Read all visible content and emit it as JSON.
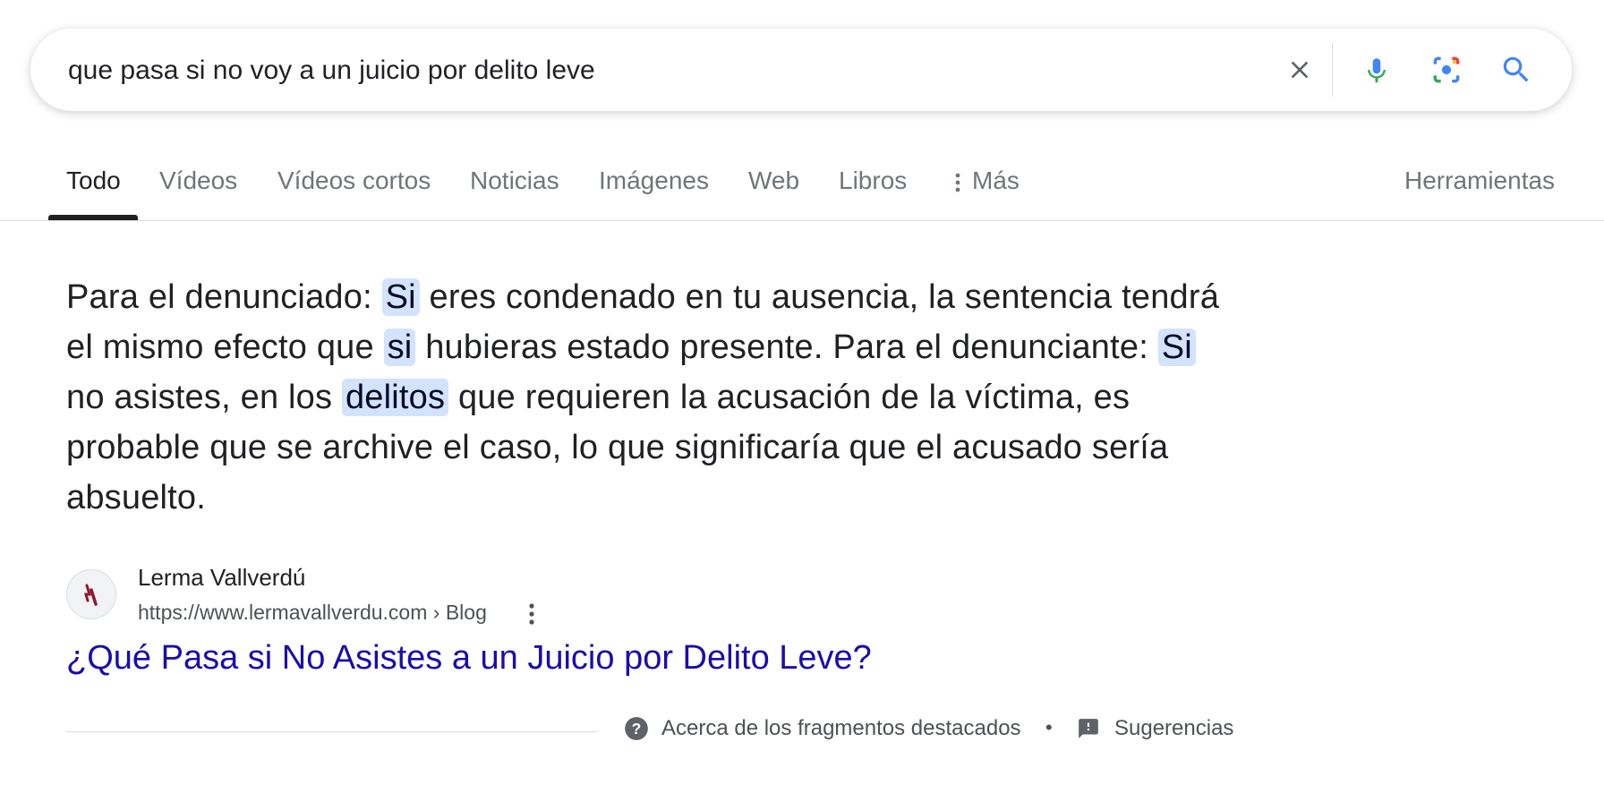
{
  "search": {
    "query": "que pasa si no voy a un juicio por delito leve",
    "icons": [
      "clear-icon",
      "microphone-icon",
      "lens-icon",
      "search-icon"
    ]
  },
  "tabs": [
    {
      "label": "Todo",
      "active": true
    },
    {
      "label": "Vídeos"
    },
    {
      "label": "Vídeos cortos"
    },
    {
      "label": "Noticias"
    },
    {
      "label": "Imágenes"
    },
    {
      "label": "Web"
    },
    {
      "label": "Libros"
    },
    {
      "label": "Más"
    }
  ],
  "tools_label": "Herramientas",
  "snippet": {
    "parts": [
      {
        "text": "Para el denunciado: "
      },
      {
        "text": "Si",
        "hl": true
      },
      {
        "text": " eres condenado en tu ausencia, la sentencia tendrá el mismo efecto que "
      },
      {
        "text": "si",
        "hl": true
      },
      {
        "text": " hubieras estado presente. Para el denunciante: "
      },
      {
        "text": "Si",
        "hl": true
      },
      {
        "text": " no asistes, en los "
      },
      {
        "text": "delitos",
        "hl": true
      },
      {
        "text": " que requieren la acusación de la víctima, es probable que se archive el caso, lo que significaría que el acusado sería absuelto."
      }
    ]
  },
  "source": {
    "name": "Lerma Vallverdú",
    "url": "https://www.lermavallverdu.com › Blog",
    "title": "¿Qué Pasa si No Asistes a un Juicio por Delito Leve?"
  },
  "footer": {
    "about": "Acerca de los fragmentos destacados",
    "separator": "•",
    "feedback": "Sugerencias"
  },
  "colors": {
    "highlight": "#d3e3fd",
    "link": "#1a0dab",
    "logo": "#8b1a2b"
  }
}
